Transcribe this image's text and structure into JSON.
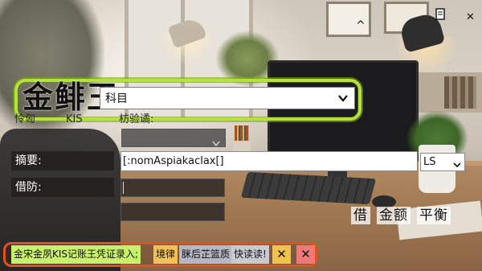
{
  "window": {
    "minimize_glyph": "^",
    "close_glyph": "✕",
    "doc_icon": "document-icon"
  },
  "header": {
    "title": "金鲱王"
  },
  "account": {
    "label": "科目",
    "value": "",
    "dropdown_icon": "chevron-down-icon"
  },
  "sub_labels": {
    "left": "怜匈",
    "middle": "KIS",
    "right": "枋验谲:"
  },
  "summary": {
    "label": "摘要:",
    "value": "[:nomAspiakaclax[]",
    "unit_select": "LS"
  },
  "borrow": {
    "label": "借防:"
  },
  "amount_header": {
    "debit": "借",
    "amount": "金额",
    "balance": "平衡"
  },
  "status": {
    "message": "金宋金夙KIS记账王凭证录入;",
    "buttons": [
      "境律",
      "脒后芷篮质",
      "快读读!"
    ],
    "close_labels": [
      "✕",
      "✕"
    ]
  },
  "colors": {
    "highlight_ring": "#b6e03a",
    "status_ring": "#e0521e",
    "status_text_bg": "#c8f06a",
    "btn_yellow": "#f2c054",
    "btn_red": "#f07878"
  }
}
